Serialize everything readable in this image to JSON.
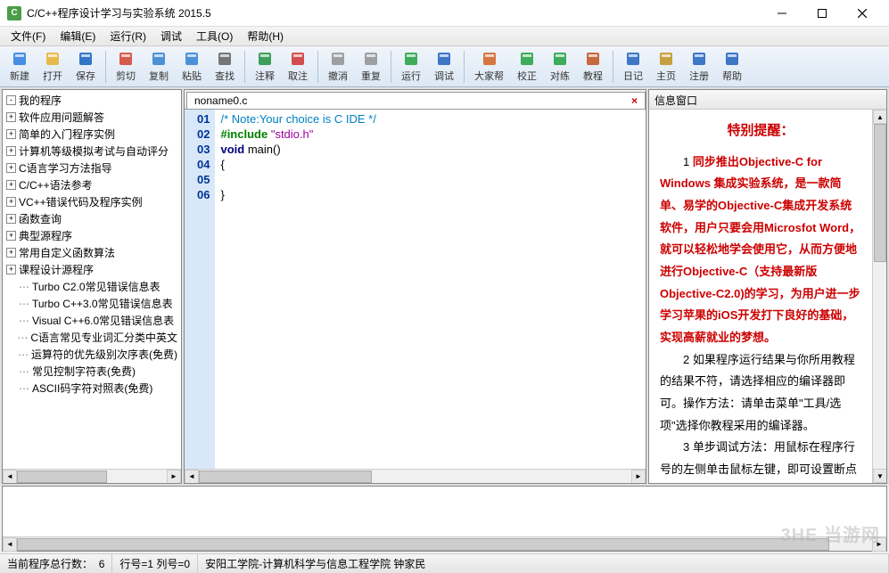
{
  "window": {
    "icon_letter": "C",
    "title": "C/C++程序设计学习与实验系统 2015.5"
  },
  "menus": [
    {
      "label": "文件(F)"
    },
    {
      "label": "编辑(E)"
    },
    {
      "label": "运行(R)"
    },
    {
      "label": "调试"
    },
    {
      "label": "工具(O)"
    },
    {
      "label": "帮助(H)"
    }
  ],
  "toolbar": [
    {
      "name": "new",
      "label": "新建",
      "color": "#2a7de1"
    },
    {
      "name": "open",
      "label": "打开",
      "color": "#e8b030"
    },
    {
      "name": "save",
      "label": "保存",
      "color": "#1060c0"
    },
    {
      "sep": true
    },
    {
      "name": "cut",
      "label": "剪切",
      "color": "#d04030"
    },
    {
      "name": "copy",
      "label": "复制",
      "color": "#3080d0"
    },
    {
      "name": "paste",
      "label": "粘贴",
      "color": "#3080d0"
    },
    {
      "name": "find",
      "label": "查找",
      "color": "#606060"
    },
    {
      "sep": true
    },
    {
      "name": "comment",
      "label": "注释",
      "color": "#209040"
    },
    {
      "name": "uncomment",
      "label": "取注",
      "color": "#d03030"
    },
    {
      "sep": true
    },
    {
      "name": "undo",
      "label": "撤消",
      "color": "#909090"
    },
    {
      "name": "redo",
      "label": "重复",
      "color": "#909090"
    },
    {
      "sep": true
    },
    {
      "name": "run",
      "label": "运行",
      "color": "#20a040"
    },
    {
      "name": "debug",
      "label": "调试",
      "color": "#2060c0"
    },
    {
      "sep": true
    },
    {
      "name": "help-all",
      "label": "大家帮",
      "color": "#d06020"
    },
    {
      "name": "check",
      "label": "校正",
      "color": "#20a040"
    },
    {
      "name": "practice",
      "label": "对练",
      "color": "#20a040"
    },
    {
      "name": "tutorial",
      "label": "教程",
      "color": "#c05020"
    },
    {
      "sep": true
    },
    {
      "name": "diary",
      "label": "日记",
      "color": "#2060c0"
    },
    {
      "name": "home",
      "label": "主页",
      "color": "#c09020"
    },
    {
      "name": "register",
      "label": "注册",
      "color": "#2060c0"
    },
    {
      "name": "help",
      "label": "帮助",
      "color": "#2060c0"
    }
  ],
  "tree": [
    {
      "label": "我的程序",
      "type": "root",
      "toggle": "-"
    },
    {
      "label": "软件应用问题解答",
      "toggle": "+"
    },
    {
      "label": "简单的入门程序实例",
      "toggle": "+"
    },
    {
      "label": "计算机等级模拟考试与自动评分",
      "toggle": "+"
    },
    {
      "label": "C语言学习方法指导",
      "toggle": "+"
    },
    {
      "label": "C/C++语法参考",
      "toggle": "+"
    },
    {
      "label": "VC++错误代码及程序实例",
      "toggle": "+"
    },
    {
      "label": "函数查询",
      "toggle": "+"
    },
    {
      "label": "典型源程序",
      "toggle": "+"
    },
    {
      "label": "常用自定义函数算法",
      "toggle": "+"
    },
    {
      "label": "课程设计源程序",
      "toggle": "+"
    },
    {
      "label": "Turbo C2.0常见错误信息表",
      "leaf": true
    },
    {
      "label": "Turbo C++3.0常见错误信息表",
      "leaf": true
    },
    {
      "label": "Visual C++6.0常见错误信息表",
      "leaf": true
    },
    {
      "label": "C语言常见专业词汇分类中英文",
      "leaf": true
    },
    {
      "label": "运算符的优先级别次序表(免费)",
      "leaf": true
    },
    {
      "label": "常见控制字符表(免费)",
      "leaf": true
    },
    {
      "label": "ASCII码字符对照表(免费)",
      "leaf": true
    }
  ],
  "editor": {
    "tab_name": "noname0.c",
    "lines": [
      {
        "n": "01",
        "segs": [
          {
            "t": "/* Note:Your choice is C IDE */",
            "c": "comment"
          }
        ]
      },
      {
        "n": "02",
        "segs": [
          {
            "t": "#include ",
            "c": "preproc"
          },
          {
            "t": "\"stdio.h\"",
            "c": "string"
          }
        ]
      },
      {
        "n": "03",
        "segs": [
          {
            "t": "void",
            "c": "keyword"
          },
          {
            "t": " main()",
            "c": ""
          }
        ]
      },
      {
        "n": "04",
        "segs": [
          {
            "t": "{",
            "c": ""
          }
        ]
      },
      {
        "n": "05",
        "segs": [
          {
            "t": "",
            "c": ""
          }
        ]
      },
      {
        "n": "06",
        "segs": [
          {
            "t": "}",
            "c": ""
          }
        ]
      }
    ]
  },
  "info": {
    "header": "信息窗口",
    "title": "特别提醒：",
    "p1_prefix": "1 ",
    "p1_red": "同步推出Objective-C for Windows 集成实验系统，是一款简单、易学的Objective-C集成开发系统软件，用户只要会用Microsfot Word，就可以轻松地学会使用它，从而方便地进行Objective-C（支持最新版Objective-C2.0)的学习，为用户进一步学习苹果的iOS开发打下良好的基础，实现高薪就业的梦想。",
    "p2": "2 如果程序运行结果与你所用教程的结果不符，请选择相应的编译器即可。操作方法：请单击菜单\"工具/选项\"选择你教程采用的编译器。",
    "p3": "3 单步调试方法：用鼠标在程序行号的左侧单击鼠标左键，即可设置断点"
  },
  "status": {
    "lines_label": "当前程序总行数：",
    "lines_value": "6",
    "pos": "行号=1  列号=0",
    "org": "安阳工学院-计算机科学与信息工程学院   钟家民"
  },
  "watermark": {
    "big": "当游网",
    "small": "3HE"
  }
}
